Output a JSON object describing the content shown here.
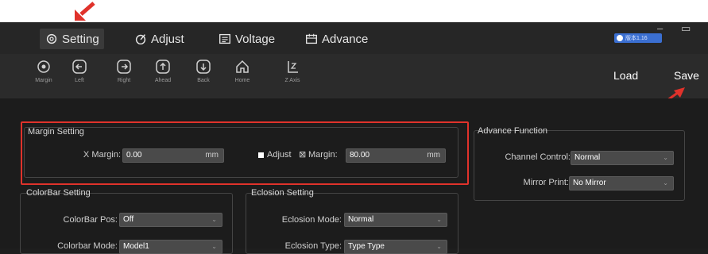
{
  "tabs": [
    {
      "label": "Setting",
      "icon": "gear-icon"
    },
    {
      "label": "Adjust",
      "icon": "adjust-icon"
    },
    {
      "label": "Voltage",
      "icon": "voltage-icon"
    },
    {
      "label": "Advance",
      "icon": "advance-icon"
    }
  ],
  "window": {
    "minimize": "–",
    "maximize": "▭",
    "badge_text": "版本1.16"
  },
  "toolbar": {
    "items": [
      {
        "label": "Margin",
        "icon": "target-icon"
      },
      {
        "label": "Left",
        "icon": "arrow-left-icon"
      },
      {
        "label": "Right",
        "icon": "arrow-right-icon"
      },
      {
        "label": "Ahead",
        "icon": "arrow-up-icon"
      },
      {
        "label": "Back",
        "icon": "arrow-down-icon"
      },
      {
        "label": "Home",
        "icon": "home-icon"
      },
      {
        "label": "Z Axis",
        "icon": "z-axis-icon"
      }
    ],
    "load_label": "Load",
    "save_label": "Save"
  },
  "margin_setting": {
    "title": "Margin Setting",
    "x_margin_label": "X Margin:",
    "x_margin_value": "0.00",
    "x_margin_unit": "mm",
    "adjust_label": "Adjust",
    "margin_label": "Margin:",
    "margin_value": "80.00",
    "margin_unit": "mm"
  },
  "advance_function": {
    "title": "Advance Function",
    "channel_control_label": "Channel Control:",
    "channel_control_value": "Normal",
    "mirror_print_label": "Mirror Print:",
    "mirror_print_value": "No Mirror"
  },
  "colorbar_setting": {
    "title": "ColorBar Setting",
    "pos_label": "ColorBar Pos:",
    "pos_value": "Off",
    "mode_label": "Colorbar Mode:",
    "mode_value": "Model1"
  },
  "eclosion_setting": {
    "title": "Eclosion Setting",
    "mode_label": "Eclosion Mode:",
    "mode_value": "Normal",
    "type_label": "Eclosion Type:",
    "type_value": "Type Type"
  },
  "colors": {
    "highlight": "#e0322b",
    "accent": "#3b6fd1"
  }
}
